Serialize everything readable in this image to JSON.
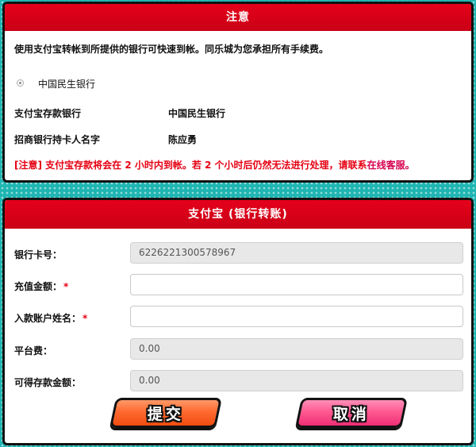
{
  "notice": {
    "title": "注意",
    "intro": "使用支付宝转帐到所提供的银行可快速到帐。同乐城为您承担所有手续费。",
    "bank_option": "中国民生银行",
    "deposit_bank_label": "支付宝存款银行",
    "deposit_bank_value": "中国民生银行",
    "holder_label": "招商银行持卡人名字",
    "holder_value": "陈应勇",
    "warning_text": "[注意] 支付宝存款将会在 2 小时内到帐。若 2 个小时后仍然无法进行处理，请联系",
    "warning_link": "在线客服。"
  },
  "form": {
    "title": "支付宝 (银行转账)",
    "card_label": "银行卡号：",
    "card_value": "6226221300578967",
    "amount_label": "充值金额：",
    "amount_value": "",
    "name_label": "入款账户姓名：",
    "name_value": "",
    "required_mark": "*",
    "fee_label": "平台费：",
    "fee_value": "0.00",
    "available_label": "可得存款金额：",
    "available_value": "0.00",
    "submit_label": "提交",
    "cancel_label": "取消"
  },
  "colors": {
    "header_red": "#e5001a",
    "background_teal": "#1fb5b2",
    "submit_orange": "#ff6a2f",
    "cancel_pink": "#ff5a92",
    "warning_red": "#e60012"
  },
  "icons": {
    "bank_radio": "radio-selected"
  }
}
